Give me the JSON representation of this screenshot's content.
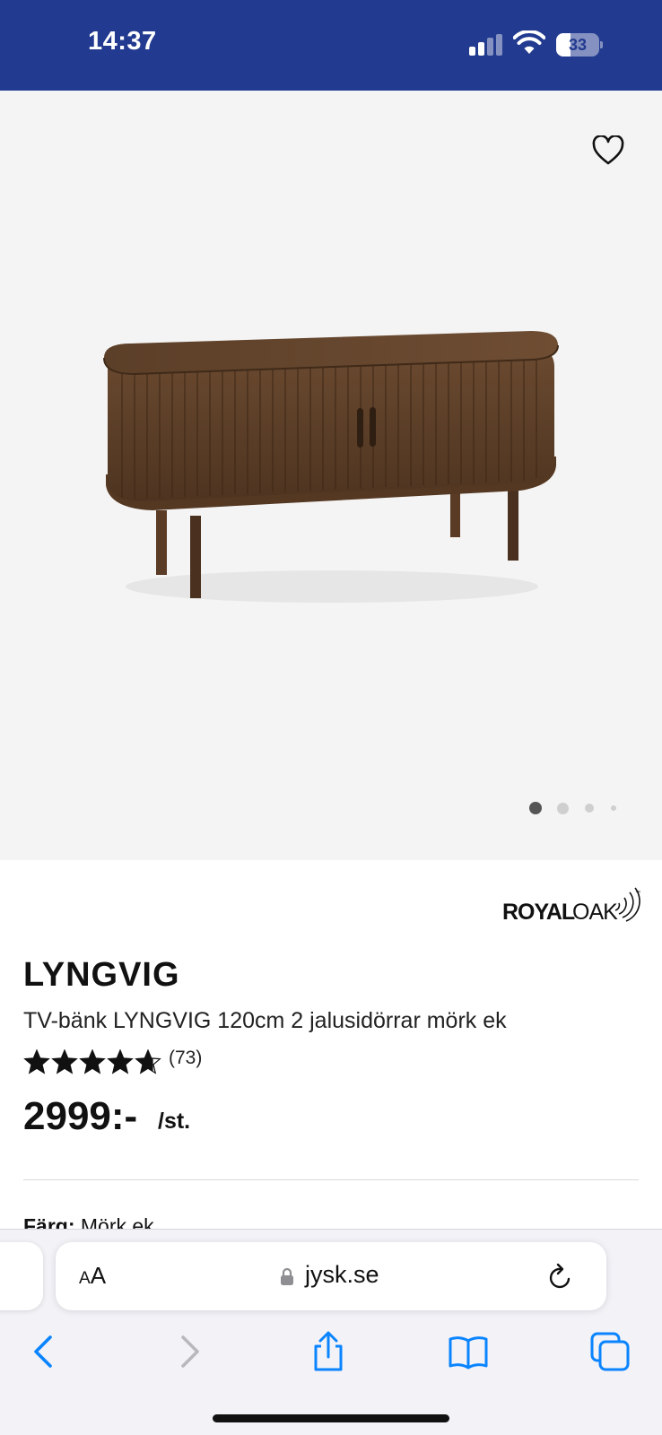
{
  "status_bar": {
    "time": "14:37",
    "battery": "33",
    "background": "#223a8f"
  },
  "gallery": {
    "total_images": 4,
    "active_index": 0,
    "wishlist_icon": "heart-outline-icon"
  },
  "product": {
    "brand": "ROYAL OAK",
    "name": "LYNGVIG",
    "description": "TV-bänk LYNGVIG 120cm 2 jalusidörrar mörk ek",
    "rating": 4.7,
    "rating_max": 5,
    "review_count": "(73)",
    "price": "2999:-",
    "unit": "/st.",
    "color_label": "Färg:",
    "color_value": "Mörk ek"
  },
  "browser": {
    "text_size_label_small": "A",
    "text_size_label_large": "A",
    "url": "jysk.se",
    "toolbar_icons": [
      "back-icon",
      "forward-icon",
      "share-icon",
      "bookmarks-icon",
      "tabs-icon"
    ],
    "accent_color": "#0a84ff"
  }
}
